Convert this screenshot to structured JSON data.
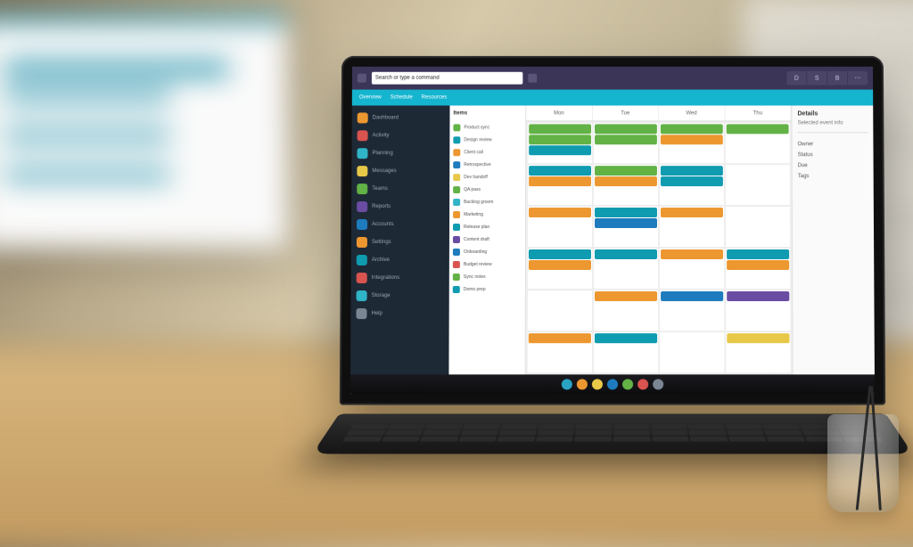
{
  "topbar": {
    "address": "Search or type a command",
    "tabs": [
      "D",
      "S",
      "B",
      "⋯"
    ]
  },
  "filterbar": {
    "items": [
      "Overview",
      "Schedule",
      "Resources"
    ]
  },
  "sidebar": {
    "items": [
      {
        "label": "Dashboard",
        "color": "#ed9730"
      },
      {
        "label": "Activity",
        "color": "#d9534f"
      },
      {
        "label": "Planning",
        "color": "#30b4c7"
      },
      {
        "label": "Messages",
        "color": "#e7c848"
      },
      {
        "label": "Teams",
        "color": "#62b246"
      },
      {
        "label": "Reports",
        "color": "#6a4ca3"
      },
      {
        "label": "Accounts",
        "color": "#1d7bbe"
      },
      {
        "label": "Settings",
        "color": "#ed9730"
      },
      {
        "label": "Archive",
        "color": "#0f9bb0"
      },
      {
        "label": "Integrations",
        "color": "#d9534f"
      },
      {
        "label": "Storage",
        "color": "#30b4c7"
      },
      {
        "label": "Help",
        "color": "#7a8693"
      }
    ]
  },
  "list": {
    "heading": "Items",
    "rows": [
      {
        "label": "Product sync",
        "color": "#62b246"
      },
      {
        "label": "Design review",
        "color": "#0f9bb0"
      },
      {
        "label": "Client call",
        "color": "#ed9730"
      },
      {
        "label": "Retrospective",
        "color": "#1d7bbe"
      },
      {
        "label": "Dev handoff",
        "color": "#e7c848"
      },
      {
        "label": "QA pass",
        "color": "#62b246"
      },
      {
        "label": "Backlog groom",
        "color": "#30b4c7"
      },
      {
        "label": "Marketing",
        "color": "#ed9730"
      },
      {
        "label": "Release plan",
        "color": "#0f9bb0"
      },
      {
        "label": "Content draft",
        "color": "#6a4ca3"
      },
      {
        "label": "Onboarding",
        "color": "#1d7bbe"
      },
      {
        "label": "Budget review",
        "color": "#d9534f"
      },
      {
        "label": "Sync notes",
        "color": "#62b246"
      },
      {
        "label": "Demo prep",
        "color": "#0f9bb0"
      }
    ]
  },
  "calendar": {
    "day_headers": [
      "Mon",
      "Tue",
      "Wed",
      "Thu"
    ],
    "cells": [
      [
        {
          "c": "c-green"
        },
        {
          "c": "c-green"
        },
        {
          "c": "c-teal"
        }
      ],
      [
        {
          "c": "c-green"
        },
        {
          "c": "c-green"
        }
      ],
      [
        {
          "c": "c-green"
        },
        {
          "c": "c-orange"
        }
      ],
      [
        {
          "c": "c-green"
        }
      ],
      [
        {
          "c": "c-teal"
        },
        {
          "c": "c-orange"
        }
      ],
      [
        {
          "c": "c-green"
        },
        {
          "c": "c-orange"
        }
      ],
      [
        {
          "c": "c-teal"
        },
        {
          "c": "c-teal"
        }
      ],
      [],
      [
        {
          "c": "c-orange"
        }
      ],
      [
        {
          "c": "c-teal"
        },
        {
          "c": "c-blue"
        }
      ],
      [
        {
          "c": "c-orange"
        }
      ],
      [],
      [
        {
          "c": "c-teal"
        },
        {
          "c": "c-orange"
        }
      ],
      [
        {
          "c": "c-teal"
        }
      ],
      [
        {
          "c": "c-orange"
        }
      ],
      [
        {
          "c": "c-teal"
        },
        {
          "c": "c-orange"
        }
      ],
      [],
      [
        {
          "c": "c-orange"
        }
      ],
      [
        {
          "c": "c-blue"
        }
      ],
      [
        {
          "c": "c-purple"
        }
      ],
      [
        {
          "c": "c-orange"
        }
      ],
      [
        {
          "c": "c-teal"
        }
      ],
      [],
      [
        {
          "c": "c-yellow"
        }
      ]
    ]
  },
  "details": {
    "title": "Details",
    "subtitle": "Selected event info",
    "lines": [
      "Owner",
      "Status",
      "Due",
      "Tags"
    ]
  },
  "taskbar": {
    "icons": [
      {
        "name": "start-icon",
        "color": "#2aa3c4"
      },
      {
        "name": "browser-icon",
        "color": "#ed9730"
      },
      {
        "name": "files-icon",
        "color": "#e7c848"
      },
      {
        "name": "mail-icon",
        "color": "#1d7bbe"
      },
      {
        "name": "chat-icon",
        "color": "#62b246"
      },
      {
        "name": "store-icon",
        "color": "#d9534f"
      },
      {
        "name": "more-icon",
        "color": "#7a8693"
      }
    ]
  }
}
